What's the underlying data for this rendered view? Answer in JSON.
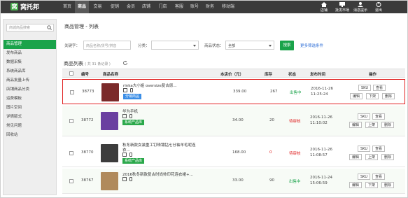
{
  "brand": {
    "name": "窝托邦",
    "tagline": "·· ·· ·· ··",
    "mark": "窝"
  },
  "nav": [
    {
      "label": "首页"
    },
    {
      "label": "商品",
      "active": true
    },
    {
      "label": "交易"
    },
    {
      "label": "促销"
    },
    {
      "label": "会员"
    },
    {
      "label": "店铺"
    },
    {
      "label": "门店"
    },
    {
      "label": "客服"
    },
    {
      "label": "账号"
    },
    {
      "label": "财务"
    },
    {
      "label": "移动端"
    }
  ],
  "tools": [
    {
      "label": "店铺",
      "icon": "home-icon"
    },
    {
      "label": "批发市场",
      "icon": "market-icon"
    },
    {
      "label": "消息提示",
      "icon": "user-icon"
    },
    {
      "label": "退出",
      "icon": "power-icon"
    }
  ],
  "sidebar": {
    "search_placeholder": "商城商品搜索",
    "items": [
      {
        "label": "商品管理",
        "active": true
      },
      {
        "label": "发布商品"
      },
      {
        "label": "数据采集"
      },
      {
        "label": "系统商品库"
      },
      {
        "label": "商品批量上传"
      },
      {
        "label": "店铺商品分类"
      },
      {
        "label": "运费模板"
      },
      {
        "label": "图片空间"
      },
      {
        "label": "详情版式"
      },
      {
        "label": "常见问题"
      },
      {
        "label": "回收站"
      }
    ]
  },
  "breadcrumb": "商品管理 - 列表",
  "filter": {
    "keyword_label": "关键字：",
    "keyword_placeholder": "商品名称/货号/拼音",
    "category_label": "分类：",
    "category_value": "",
    "status_label": "商品状态：",
    "status_value": "全部",
    "search_button": "搜索",
    "more_link": "更多筛选条件"
  },
  "list": {
    "title": "商品列表",
    "count_text": "( 共 31 条记录 )",
    "columns": [
      "编号",
      "商品名称",
      "本店价（元）",
      "库存",
      "状态",
      "发布时间",
      "操作"
    ],
    "rows": [
      {
        "id": "38773",
        "name": "rinka大小姐 oversize复古原...",
        "name2": "",
        "tag": "分销商品",
        "tag_color": "blue",
        "price": "339.00",
        "stock": "267",
        "status": "出售中",
        "status_type": "on",
        "date": "2016-11-26",
        "time": "11:25:24",
        "actions_top": [
          "SKU",
          "查看"
        ],
        "actions_bottom": [
          "编辑",
          "下架",
          "删除"
        ],
        "thumb_color": "#7b2a2a",
        "highlight": true
      },
      {
        "id": "38772",
        "name": "华为手机",
        "name2": "",
        "tag": "系统产品库",
        "tag_color": "green",
        "price": "34.00",
        "stock": "20",
        "status": "待审核",
        "status_type": "off",
        "date": "2016-11-26",
        "time": "11:10:02",
        "actions_top": [
          "SKU",
          "查看"
        ],
        "actions_bottom": [
          "编辑",
          "上架",
          "删除"
        ],
        "thumb_color": "#6a3fa0",
        "highlight": false
      },
      {
        "id": "38770",
        "name": "秋冬新款女装重工钉珠镶钻七分袖羊毛呢连",
        "name2": "衣...",
        "tag": "系统产品库",
        "tag_color": "green",
        "price": "168.00",
        "stock": "0",
        "status": "待审核",
        "status_type": "off",
        "date": "2016-11-26",
        "time": "11:08:57",
        "actions_top": [
          "SKU",
          "查看"
        ],
        "actions_bottom": [
          "编辑",
          "上架",
          "删除"
        ],
        "thumb_color": "#3c3c3c",
        "highlight": false
      },
      {
        "id": "38767",
        "name": "2016秋冬新款复古时尚帅印花连衣裙+...",
        "name2": "",
        "tag": "",
        "tag_color": "",
        "price": "33.00",
        "stock": "90",
        "status": "出售中",
        "status_type": "on",
        "date": "2016-11-24",
        "time": "15:06:59",
        "actions_top": [
          "SKU",
          "查看"
        ],
        "actions_bottom": [
          "编辑",
          "下架",
          "删除"
        ],
        "thumb_color": "#b08a5c",
        "highlight": false
      }
    ]
  },
  "colors": {
    "accent": "#1aa34a",
    "topbar": "#3b3b3b",
    "alert": "#e02020",
    "link": "#2b6cd6"
  }
}
